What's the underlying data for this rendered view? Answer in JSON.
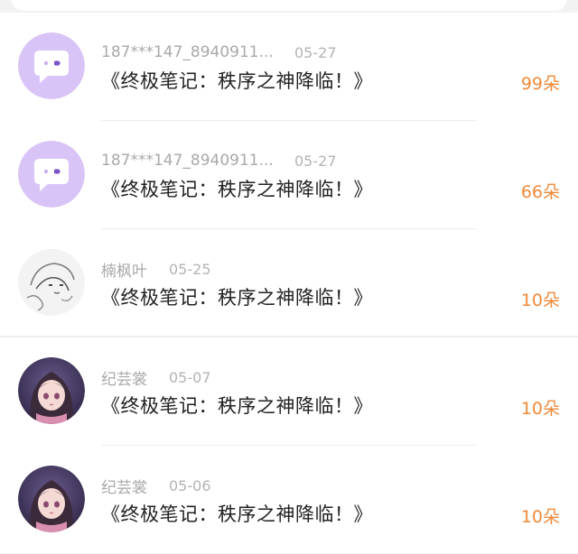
{
  "gifts": [
    {
      "user": "187***147_8940911...",
      "date": "05-27",
      "book": "《终极笔记：秩序之神降临！》",
      "amount": "99朵",
      "avatar": "chat-bubble-icon"
    },
    {
      "user": "187***147_8940911...",
      "date": "05-27",
      "book": "《终极笔记：秩序之神降临！》",
      "amount": "66朵",
      "avatar": "chat-bubble-icon"
    },
    {
      "user": "楠枫叶",
      "date": "05-25",
      "book": "《终极笔记：秩序之神降临！》",
      "amount": "10朵",
      "avatar": "sketch-character-avatar"
    },
    {
      "user": "纪芸裳",
      "date": "05-07",
      "book": "《终极笔记：秩序之神降临！》",
      "amount": "10朵",
      "avatar": "anime-girl-avatar"
    },
    {
      "user": "纪芸裳",
      "date": "05-06",
      "book": "《终极笔记：秩序之神降临！》",
      "amount": "10朵",
      "avatar": "anime-girl-avatar"
    }
  ],
  "colors": {
    "accent": "#f08a3a",
    "avatar_purple": "#d9c4f7",
    "muted_text": "#a9a9a9"
  }
}
